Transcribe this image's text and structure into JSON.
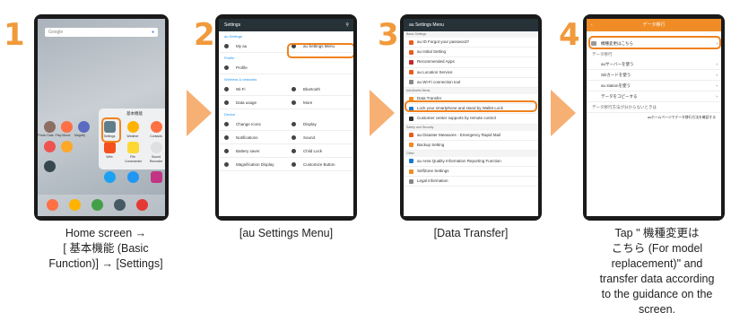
{
  "steps": [
    {
      "number": "1",
      "caption": [
        "Home screen →",
        "[ 基本機能 (Basic",
        "Function)] → [Settings]"
      ]
    },
    {
      "number": "2",
      "caption": [
        "[au Settings Menu]"
      ]
    },
    {
      "number": "3",
      "caption": [
        "[Data Transfer]"
      ]
    },
    {
      "number": "4",
      "caption": [
        "Tap \" 機種変更は",
        "こちら (For model",
        "replacement)\" and",
        "transfer data according",
        "to the guidance on the",
        "screen."
      ]
    }
  ],
  "phone1": {
    "search_text": "Google",
    "folder_title": "基本機能",
    "folder_apps": [
      "Settings",
      "Weather",
      "Contacts",
      "Web",
      "File Commander",
      "Sound Recorder",
      "Twitter",
      "Messenger",
      "Instagram"
    ],
    "home_labels": [
      "Photo Date",
      "Play Music",
      "Magnify",
      "Recorder",
      "Amazon"
    ]
  },
  "phone2": {
    "title": "Settings",
    "sections": [
      {
        "label": "au Settings",
        "rows": [
          [
            "My au",
            "au Settings Menu"
          ]
        ]
      },
      {
        "label": "Profile",
        "rows": [
          [
            "Profile",
            ""
          ]
        ]
      },
      {
        "label": "Wireless & networks",
        "rows": [
          [
            "Wi-Fi",
            "Bluetooth"
          ],
          [
            "Data usage",
            "More"
          ]
        ]
      },
      {
        "label": "Device",
        "rows": [
          [
            "Change Icons",
            "Display"
          ],
          [
            "Notifications",
            "Sound"
          ],
          [
            "Battery saver",
            "Child Lock"
          ],
          [
            "Magnification Display",
            "Customize Button"
          ]
        ]
      }
    ]
  },
  "phone3": {
    "title": "au Settings Menu",
    "items": [
      {
        "type": "section",
        "text": "Basic Settings"
      },
      {
        "type": "row",
        "text": "au ID Forgot your password?",
        "color": "#e95b1e"
      },
      {
        "type": "row",
        "text": "au Initial Setting",
        "color": "#e95b1e"
      },
      {
        "type": "row",
        "text": "Recommended Apps",
        "color": "#c62828"
      },
      {
        "type": "row",
        "text": "au Location Service",
        "color": "#e95b1e"
      },
      {
        "type": "row",
        "text": "au Wi-Fi connection tool",
        "color": "#888888"
      },
      {
        "type": "section",
        "text": "Info/Useful Items"
      },
      {
        "type": "row",
        "text": "Data Transfer",
        "color": "#f08c25"
      },
      {
        "type": "row",
        "text": "Lock your smartphone and stand by Wallet Lock",
        "color": "#1976d2"
      },
      {
        "type": "row",
        "text": "Customer center supports by remote control",
        "color": "#333333"
      },
      {
        "type": "section",
        "text": "Safety and Security"
      },
      {
        "type": "row",
        "text": "au Disaster Measures - Emergency Rapid Mail",
        "color": "#e95b1e"
      },
      {
        "type": "row",
        "text": "Backup Setting",
        "color": "#f08c25"
      },
      {
        "type": "section",
        "text": "Other"
      },
      {
        "type": "row",
        "text": "au Area Quality Information Reporting Function",
        "color": "#1976d2"
      },
      {
        "type": "row",
        "text": "SelfZone Settings",
        "color": "#f08c25"
      },
      {
        "type": "row",
        "text": "Legal information",
        "color": "#888888"
      }
    ]
  },
  "phone4": {
    "title": "データ移行",
    "rows": [
      "機種変更はこちら",
      "データ移行",
      "auサーバーを使う",
      "SDカードを使う",
      "au stationを使う",
      "データをコピーする",
      "データ移行方法が分からないときは",
      "auホームページでデータ移行方法を確認する"
    ]
  },
  "colors": {
    "accent": "#f19a3b",
    "arrow": "#f7b073",
    "highlight": "#f0821e"
  }
}
